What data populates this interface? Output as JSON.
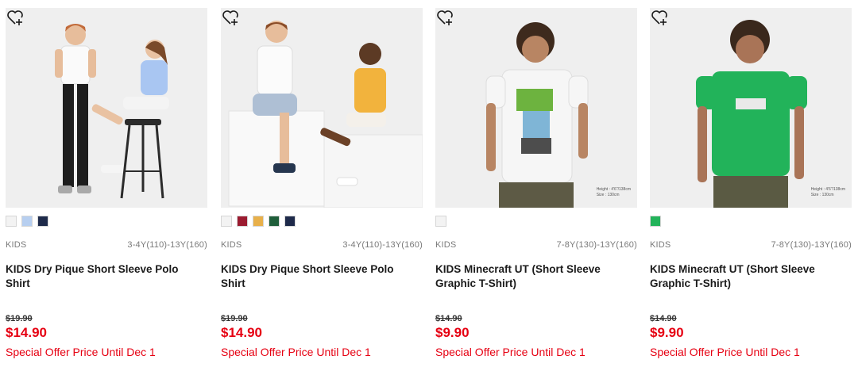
{
  "products": [
    {
      "category": "KIDS",
      "sizes": "3-4Y(110)-13Y(160)",
      "title": "KIDS Dry Pique Short Sleeve Polo Shirt",
      "original_price": "$19.90",
      "sale_price": "$14.90",
      "offer": "Special Offer Price Until Dec 1",
      "swatches": [
        "#f3f3f3",
        "#b7cff0",
        "#1e2a4a"
      ],
      "wishlist_icon": "heart-plus-icon"
    },
    {
      "category": "KIDS",
      "sizes": "3-4Y(110)-13Y(160)",
      "title": "KIDS Dry Pique Short Sleeve Polo Shirt",
      "original_price": "$19.90",
      "sale_price": "$14.90",
      "offer": "Special Offer Price Until Dec 1",
      "swatches": [
        "#f3f3f3",
        "#9b1b30",
        "#e8b04a",
        "#1f5e3a",
        "#1e2a4a"
      ],
      "wishlist_icon": "heart-plus-icon"
    },
    {
      "category": "KIDS",
      "sizes": "7-8Y(130)-13Y(160)",
      "title": "KIDS Minecraft UT (Short Sleeve Graphic T-Shirt)",
      "original_price": "$14.90",
      "sale_price": "$9.90",
      "offer": "Special Offer Price Until Dec 1",
      "swatches": [
        "#f3f3f3"
      ],
      "wishlist_icon": "heart-plus-icon",
      "image_note": [
        "Height : 4'6\"/138cm",
        "Size : 130cm"
      ]
    },
    {
      "category": "KIDS",
      "sizes": "7-8Y(130)-13Y(160)",
      "title": "KIDS Minecraft UT (Short Sleeve Graphic T-Shirt)",
      "original_price": "$14.90",
      "sale_price": "$9.90",
      "offer": "Special Offer Price Until Dec 1",
      "swatches": [
        "#22b35a"
      ],
      "wishlist_icon": "heart-plus-icon",
      "image_note": [
        "Height : 4'6\"/138cm",
        "Size : 130cm"
      ]
    }
  ]
}
